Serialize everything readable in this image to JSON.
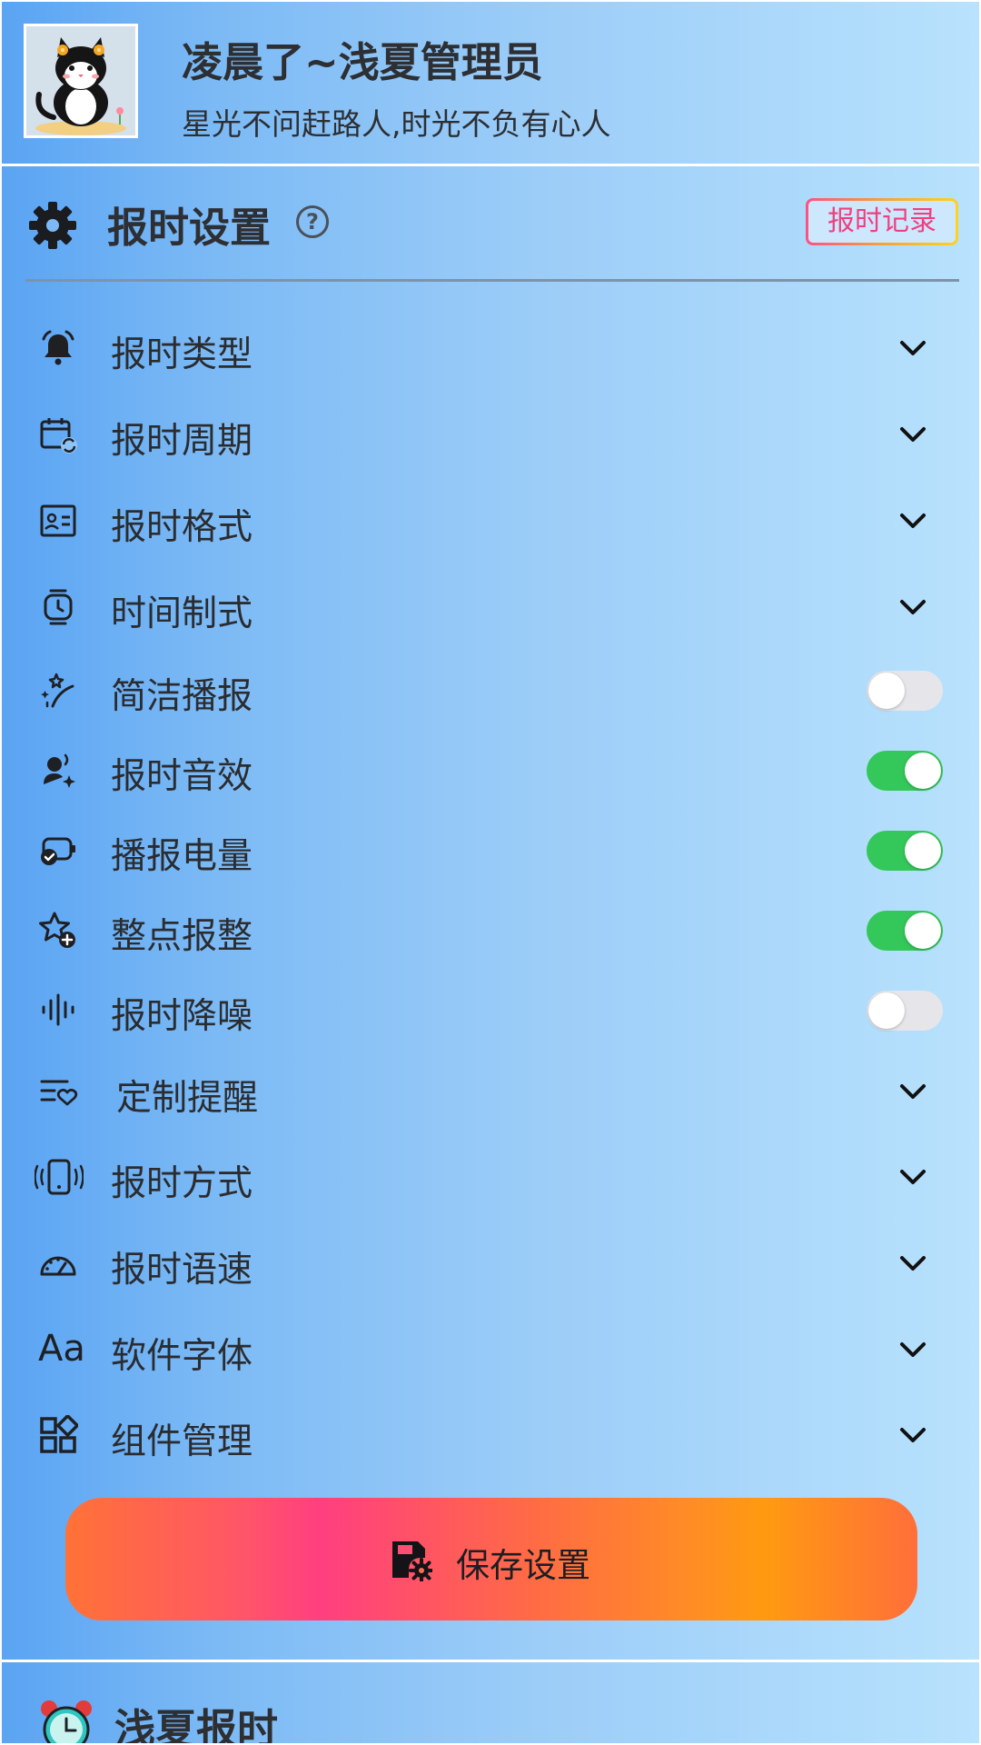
{
  "profile": {
    "name": "凌晨了~浅夏管理员",
    "motto": "星光不问赶路人,时光不负有心人"
  },
  "section": {
    "title": "报时设置",
    "help_glyph": "?",
    "record_button": "报时记录"
  },
  "settings": [
    {
      "label": "报时类型",
      "icon": "bell-icon",
      "control": "dropdown"
    },
    {
      "label": "报时周期",
      "icon": "calendar-refresh-icon",
      "control": "dropdown"
    },
    {
      "label": "报时格式",
      "icon": "id-card-icon",
      "control": "dropdown"
    },
    {
      "label": "时间制式",
      "icon": "watch-icon",
      "control": "dropdown"
    },
    {
      "label": "简洁播报",
      "icon": "magic-wand-icon",
      "control": "toggle",
      "on": false
    },
    {
      "label": "报时音效",
      "icon": "voice-sparkle-icon",
      "control": "toggle",
      "on": true
    },
    {
      "label": "播报电量",
      "icon": "battery-check-icon",
      "control": "toggle",
      "on": true
    },
    {
      "label": "整点报整",
      "icon": "star-plus-icon",
      "control": "toggle",
      "on": true
    },
    {
      "label": "报时降噪",
      "icon": "sound-wave-icon",
      "control": "toggle",
      "on": false
    },
    {
      "label": "定制提醒",
      "icon": "list-heart-icon",
      "control": "dropdown"
    },
    {
      "label": "报时方式",
      "icon": "phone-vibrate-icon",
      "control": "dropdown"
    },
    {
      "label": "报时语速",
      "icon": "speedometer-icon",
      "control": "dropdown"
    },
    {
      "label": "软件字体",
      "icon": "font-icon",
      "control": "dropdown",
      "icon_text": "Aa"
    },
    {
      "label": "组件管理",
      "icon": "widgets-icon",
      "control": "dropdown"
    }
  ],
  "save_button": "保存设置",
  "footer": {
    "title": "浅夏报时",
    "icon": "alarm-clock-icon"
  },
  "colors": {
    "toggle_on": "#34c759",
    "toggle_off": "#e6e6ea",
    "record_text": "#f0407f"
  }
}
